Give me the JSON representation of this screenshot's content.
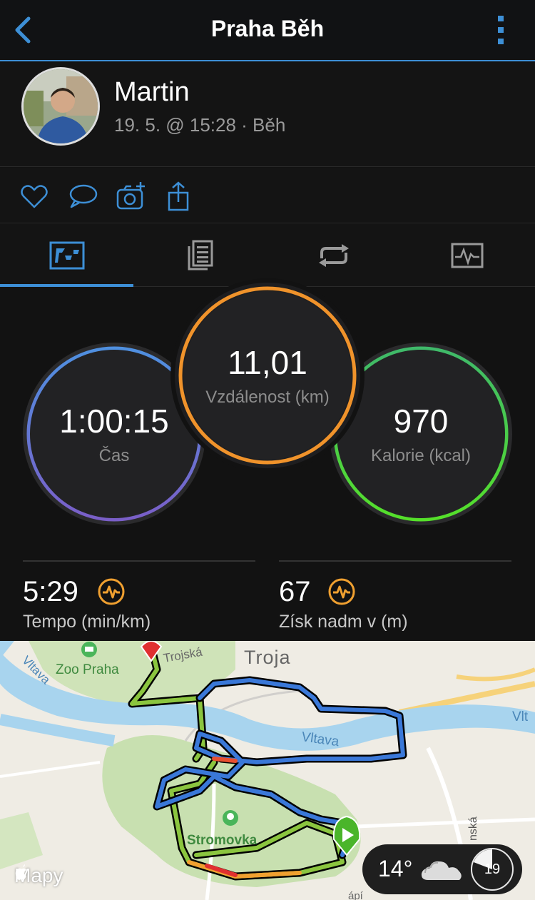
{
  "header": {
    "title": "Praha Běh",
    "back": "chevron-left-icon",
    "menu": "more-vertical-icon"
  },
  "profile": {
    "name": "Martin",
    "meta": "19. 5. @ 15:28 · Běh"
  },
  "actions": [
    "heart-icon",
    "comment-icon",
    "camera-add-icon",
    "share-icon"
  ],
  "tabs": [
    {
      "id": "overview",
      "icon": "overview-icon",
      "active": true
    },
    {
      "id": "details",
      "icon": "details-icon",
      "active": false
    },
    {
      "id": "laps",
      "icon": "laps-icon",
      "active": false
    },
    {
      "id": "charts",
      "icon": "charts-icon",
      "active": false
    }
  ],
  "stats": {
    "time": {
      "value": "1:00:15",
      "label": "Čas"
    },
    "distance": {
      "value": "11,01",
      "label": "Vzdálenost (km)"
    },
    "calories": {
      "value": "970",
      "label": "Kalorie (kcal)"
    },
    "pace": {
      "value": "5:29",
      "label": "Tempo (min/km)"
    },
    "elevation": {
      "value": "67",
      "label": "Získ nadm v (m)"
    }
  },
  "map": {
    "labels": {
      "zoo": "Zoo Praha",
      "troja": "Troja",
      "trojska": "Trojská",
      "vltava_left": "Vltava",
      "vltava_mid": "Vltava",
      "vltava_right": "Vlt",
      "stromovka": "Stromovka",
      "street_right": "nská",
      "street_bottom": "ápí"
    },
    "provider": "Mapy",
    "weather": {
      "temp": "14°",
      "icon": "cloud-icon",
      "badge": "19"
    }
  },
  "colors": {
    "accent": "#3d8fd6",
    "time_ring": "#5b7fd6",
    "distance_ring": "#f0932b",
    "calories_ring": "#4cd137",
    "metric_icon": "#f0a030"
  }
}
